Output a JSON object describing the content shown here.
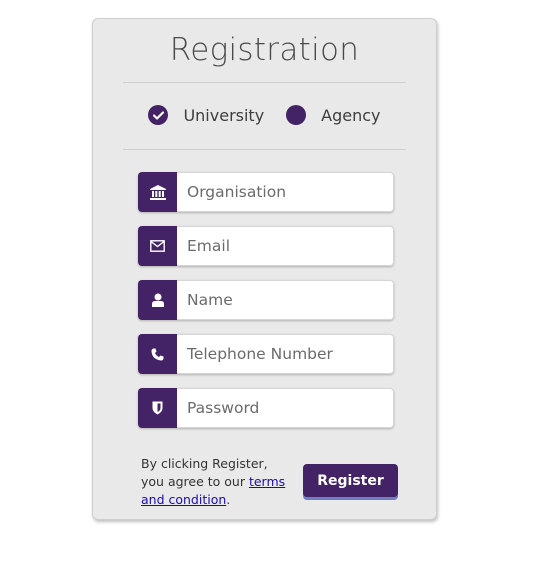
{
  "form": {
    "title": "Registration",
    "account_types": [
      {
        "label": "University",
        "selected": true,
        "icon": "check-circle-icon"
      },
      {
        "label": "Agency",
        "selected": false,
        "icon": "circle-icon"
      }
    ],
    "fields": [
      {
        "name": "organisation",
        "placeholder": "Organisation",
        "value": "",
        "icon": "bank-icon",
        "type": "text"
      },
      {
        "name": "email",
        "placeholder": "Email",
        "value": "",
        "icon": "envelope-icon",
        "type": "email"
      },
      {
        "name": "name",
        "placeholder": "Name",
        "value": "",
        "icon": "user-icon",
        "type": "text"
      },
      {
        "name": "telephone",
        "placeholder": "Telephone Number",
        "value": "",
        "icon": "phone-icon",
        "type": "tel"
      },
      {
        "name": "password",
        "placeholder": "Password",
        "value": "",
        "icon": "shield-icon",
        "type": "password"
      }
    ],
    "terms_prefix": "By clicking Register, you agree to our ",
    "terms_link": "terms and condition",
    "terms_suffix": ".",
    "submit_label": "Register"
  },
  "colors": {
    "accent": "#432266",
    "card_background": "#e9e9e9",
    "button_underline": "#6f7fc4",
    "link": "#1a0dab"
  }
}
